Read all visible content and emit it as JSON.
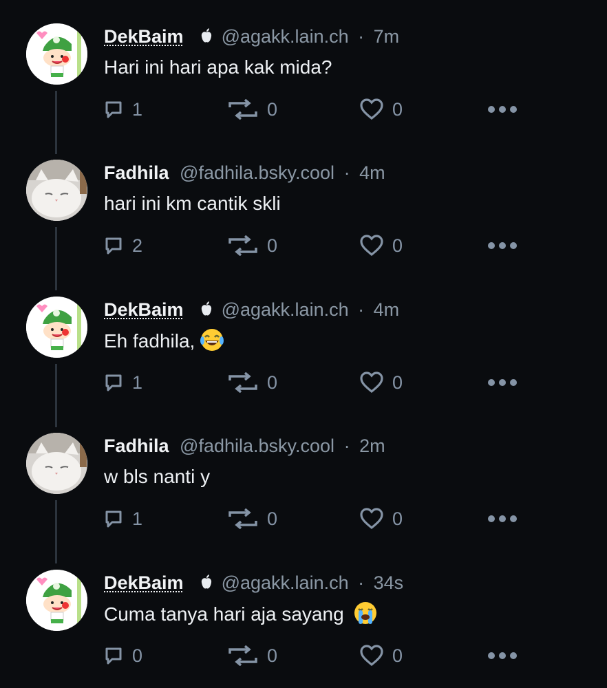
{
  "posts": [
    {
      "author": "DekBaim",
      "handle": "@agakk.lain.ch",
      "time": "7m",
      "text": "Hari ini hari apa kak mida?",
      "emoji": "",
      "avatar": "green-helmet-boy",
      "badge": "apple-icon",
      "replies": "1",
      "reposts": "0",
      "likes": "0"
    },
    {
      "author": "Fadhila",
      "handle": "@fadhila.bsky.cool",
      "time": "4m",
      "text": "hari ini km cantik skli",
      "emoji": "",
      "avatar": "white-cat",
      "badge": "",
      "replies": "2",
      "reposts": "0",
      "likes": "0"
    },
    {
      "author": "DekBaim",
      "handle": "@agakk.lain.ch",
      "time": "4m",
      "text": "Eh fadhila,",
      "emoji": "laughing-tears-emoji",
      "avatar": "green-helmet-boy",
      "badge": "apple-icon",
      "replies": "1",
      "reposts": "0",
      "likes": "0"
    },
    {
      "author": "Fadhila",
      "handle": "@fadhila.bsky.cool",
      "time": "2m",
      "text": "w bls nanti y",
      "emoji": "",
      "avatar": "white-cat",
      "badge": "",
      "replies": "1",
      "reposts": "0",
      "likes": "0"
    },
    {
      "author": "DekBaim",
      "handle": "@agakk.lain.ch",
      "time": "34s",
      "text": "Cuma tanya hari aja sayang",
      "emoji": "loudly-crying-emoji",
      "avatar": "green-helmet-boy",
      "badge": "apple-icon",
      "replies": "0",
      "reposts": "0",
      "likes": "0"
    }
  ],
  "sep": "·",
  "colors": {
    "background": "#0a0c0f",
    "muted": "#8b98a5",
    "icon": "#8594a6",
    "text": "#eef1f4"
  }
}
